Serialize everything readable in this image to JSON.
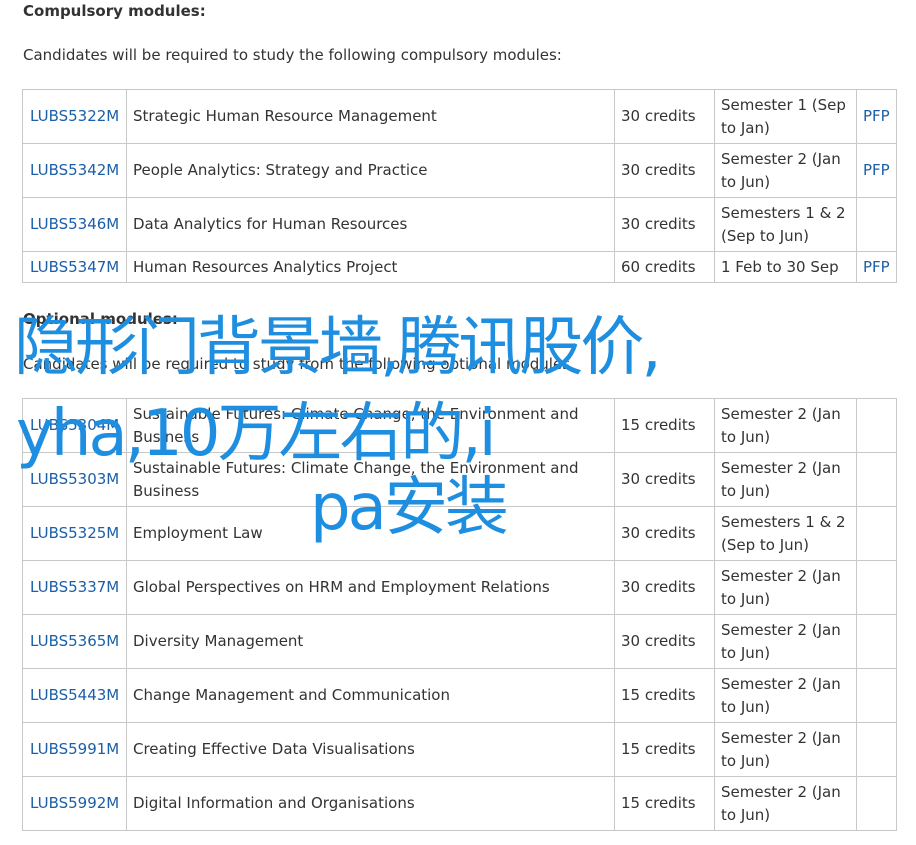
{
  "compulsory": {
    "heading": "Compulsory modules:",
    "intro": "Candidates will be required to study the following compulsory modules:",
    "rows": [
      {
        "code": "LUBS5322M",
        "title": "Strategic Human Resource Management",
        "credits": "30 credits",
        "semester": "Semester 1 (Sep to Jan)",
        "pfp": "PFP"
      },
      {
        "code": "LUBS5342M",
        "title": "People Analytics: Strategy and Practice",
        "credits": "30 credits",
        "semester": "Semester 2 (Jan to Jun)",
        "pfp": "PFP"
      },
      {
        "code": "LUBS5346M",
        "title": "Data Analytics for Human Resources",
        "credits": "30 credits",
        "semester": "Semesters 1 & 2 (Sep to Jun)",
        "pfp": ""
      },
      {
        "code": "LUBS5347M",
        "title": "Human Resources Analytics Project",
        "credits": "60 credits",
        "semester": "1 Feb to 30 Sep",
        "pfp": "PFP"
      }
    ]
  },
  "optional": {
    "heading": "Optional modules:",
    "intro": "Candidates will be required to study from the following optional modules",
    "rows": [
      {
        "code": "LUBS5304M",
        "title": "Sustainable Futures: Climate Change, the Environment and Business",
        "credits": "15 credits",
        "semester": "Semester 2 (Jan to Jun)",
        "pfp": ""
      },
      {
        "code": "LUBS5303M",
        "title": "Sustainable Futures: Climate Change, the Environment and Business",
        "credits": "30 credits",
        "semester": "Semester 2 (Jan to Jun)",
        "pfp": ""
      },
      {
        "code": "LUBS5325M",
        "title": "Employment Law",
        "credits": "30 credits",
        "semester": "Semesters 1 & 2 (Sep to Jun)",
        "pfp": ""
      },
      {
        "code": "LUBS5337M",
        "title": "Global Perspectives on HRM and Employment Relations",
        "credits": "30 credits",
        "semester": "Semester 2 (Jan to Jun)",
        "pfp": ""
      },
      {
        "code": "LUBS5365M",
        "title": "Diversity Management",
        "credits": "30 credits",
        "semester": "Semester 2 (Jan to Jun)",
        "pfp": ""
      },
      {
        "code": "LUBS5443M",
        "title": "Change Management and Communication",
        "credits": "15 credits",
        "semester": "Semester 2 (Jan to Jun)",
        "pfp": ""
      },
      {
        "code": "LUBS5991M",
        "title": "Creating Effective Data Visualisations",
        "credits": "15 credits",
        "semester": "Semester 2 (Jan to Jun)",
        "pfp": ""
      },
      {
        "code": "LUBS5992M",
        "title": "Digital Information and Organisations",
        "credits": "15 credits",
        "semester": "Semester 2 (Jan to Jun)",
        "pfp": ""
      }
    ]
  },
  "overlay": {
    "line1": "隐形门背景墙,腾讯股价,",
    "line2": "yha,10万左右的,i",
    "line3": "pa安装"
  },
  "colors": {
    "link": "#1a5fa8",
    "overlay_text": "#1e8ee0",
    "border": "#c8c8c8"
  }
}
